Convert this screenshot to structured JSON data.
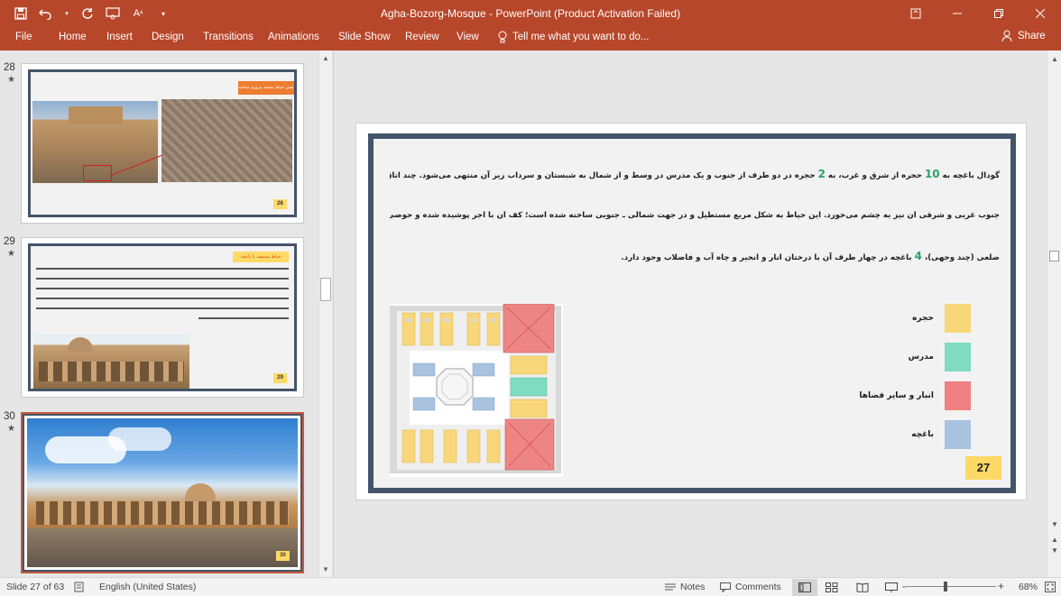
{
  "app": {
    "window_title": "Agha-Bozorg-Mosque - PowerPoint (Product Activation Failed)",
    "tell_me": "Tell me what you want to do...",
    "share": "Share"
  },
  "ribbon": {
    "tabs": [
      "File",
      "Home",
      "Insert",
      "Design",
      "Transitions",
      "Animations",
      "Slide Show",
      "Review",
      "View"
    ]
  },
  "thumbnails": [
    {
      "number": "28",
      "star": "★",
      "page": "28",
      "header": "نقش حیاط مسجد پیروزی ساخته"
    },
    {
      "number": "29",
      "star": "★",
      "page": "29",
      "header": "حیاط مسقف با باغچه"
    },
    {
      "number": "30",
      "star": "★",
      "page": "30"
    }
  ],
  "slide": {
    "line1_pre": "گودال باغچه به ",
    "n1": "10",
    "line1_mid": " حجره از شرق و غرب، به ",
    "n2": "2",
    "line1_post": " حجره در دو طرف  از جنوب و یک مدرس در وسط و از شمال به شبستان و سرداب زیر آن منتهی می‌شود. چند اتاق و انبار در دو کنج",
    "line2": "جنوب غربی و شرقی آن نیز به چشم می‌خورد. این حیاط به شکل مربع مستطیل و در جهت شمالی ـ جنوبی ساخته شده است؛ کف آن با آجر پوشیده شده و حوضی در وسط به شکل چند",
    "line3_pre": "ضلعی (چند وجهی)، ",
    "n3": "4",
    "line3_post": " باغچه در چهار طرف آن با درختان انار و انجیر و چاه آب و فاضلاب وجود دارد.",
    "legend": [
      {
        "label": "حجره",
        "color": "#f7d77a"
      },
      {
        "label": "مدرس",
        "color": "#7fdcc0"
      },
      {
        "label": "انبار و سایر فضاها",
        "color": "#ee8080"
      },
      {
        "label": "باغچه",
        "color": "#a8c2e0"
      }
    ],
    "page_number": "27"
  },
  "status": {
    "slide_info": "Slide 27 of 63",
    "language": "English (United States)",
    "notes": "Notes",
    "comments": "Comments",
    "zoom": "68%",
    "minus": "-",
    "plus": "+"
  }
}
